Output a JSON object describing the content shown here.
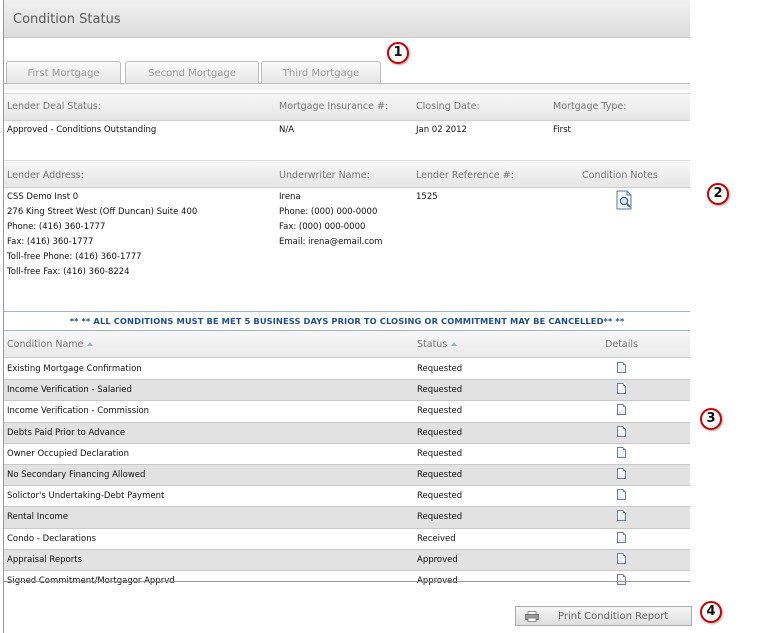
{
  "header": {
    "title": "Condition Status"
  },
  "tabs": [
    {
      "label": "First Mortgage"
    },
    {
      "label": "Second Mortgage"
    },
    {
      "label": "Third Mortgage"
    }
  ],
  "deal": {
    "labels": {
      "lender_deal_status": "Lender Deal Status:",
      "mortgage_insurance": "Mortgage Insurance #:",
      "closing_date": "Closing Date:",
      "mortgage_type": "Mortgage Type:"
    },
    "values": {
      "lender_deal_status": "Approved - Conditions Outstanding",
      "mortgage_insurance": "N/A",
      "closing_date": "Jan 02 2012",
      "mortgage_type": "First"
    }
  },
  "lender": {
    "labels": {
      "address": "Lender Address:",
      "underwriter": "Underwriter Name:",
      "reference": "Lender Reference #:",
      "condition_notes": "Condition Notes"
    },
    "address_lines": [
      "CSS Demo Inst 0",
      "276 King Street West (Off Duncan) Suite 400",
      "Phone: (416) 360-1777",
      "Fax: (416) 360-1777",
      "Toll-free Phone: (416) 360-1777",
      "Toll-free Fax: (416) 360-8224"
    ],
    "underwriter_lines": [
      "Irena",
      "Phone: (000) 000-0000",
      "Fax: (000) 000-0000",
      "Email: irena@email.com"
    ],
    "reference": "1525"
  },
  "notice": "** ** ALL CONDITIONS MUST BE MET 5 BUSINESS DAYS PRIOR TO CLOSING OR COMMITMENT MAY BE CANCELLED** **",
  "conditions": {
    "headers": {
      "name": "Condition Name",
      "status": "Status",
      "details": "Details"
    },
    "rows": [
      {
        "name": "Existing Mortgage Confirmation",
        "status": "Requested"
      },
      {
        "name": "Income Verification - Salaried",
        "status": "Requested"
      },
      {
        "name": "Income Verification - Commission",
        "status": "Requested"
      },
      {
        "name": "Debts Paid Prior to Advance",
        "status": "Requested"
      },
      {
        "name": "Owner Occupied Declaration",
        "status": "Requested"
      },
      {
        "name": "No Secondary Financing Allowed",
        "status": "Requested"
      },
      {
        "name": "Solictor's Undertaking-Debt Payment",
        "status": "Requested"
      },
      {
        "name": "Rental Income",
        "status": "Requested"
      },
      {
        "name": "Condo - Declarations",
        "status": "Received"
      },
      {
        "name": "Appraisal Reports",
        "status": "Approved"
      },
      {
        "name": "Signed Commitment/Mortgagor Apprvd",
        "status": "Approved"
      }
    ]
  },
  "print_button": {
    "label": "Print Condition Report"
  },
  "callouts": [
    "1",
    "2",
    "3",
    "4"
  ],
  "colors": {
    "callout_border": "#cc0000",
    "notice_text": "#1f4e8c",
    "sort_arrow": "#8fb3e0",
    "alt_row": "#e2e2e2"
  },
  "icons": {
    "notes": "magnifier-document-icon",
    "details": "document-icon",
    "print": "printer-icon"
  }
}
